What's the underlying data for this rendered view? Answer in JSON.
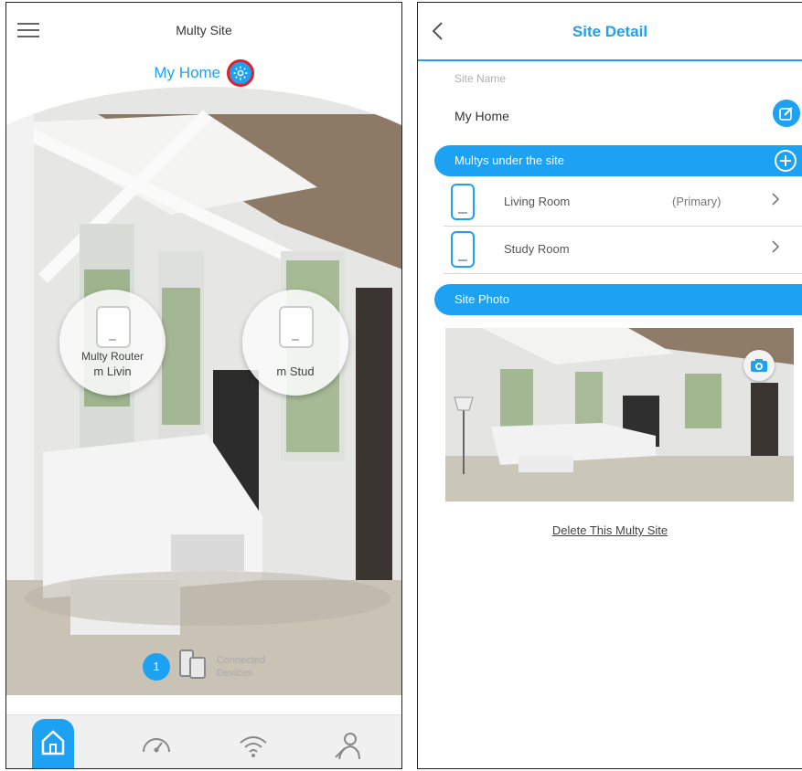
{
  "left": {
    "title": "Multy Site",
    "site_name": "My Home",
    "devices": [
      {
        "line1": "Multy Router",
        "line2": "m Livin"
      },
      {
        "line1": "",
        "line2": "m Stud"
      }
    ],
    "connected": {
      "count": "1",
      "label_1": "Connected",
      "label_2": "Devices"
    },
    "nav": [
      "home-icon",
      "speedometer-icon",
      "wifi-icon",
      "user-icon"
    ]
  },
  "right": {
    "title": "Site Detail",
    "site_name_label": "Site Name",
    "site_name_value": "My Home",
    "multys_header": "Multys under the site",
    "multys": [
      {
        "name": "Living Room",
        "role": "(Primary)"
      },
      {
        "name": "Study Room",
        "role": ""
      }
    ],
    "photo_header": "Site Photo",
    "delete_label": "Delete This Multy Site"
  },
  "colors": {
    "accent": "#1da1f2",
    "highlight": "#e0202a"
  }
}
